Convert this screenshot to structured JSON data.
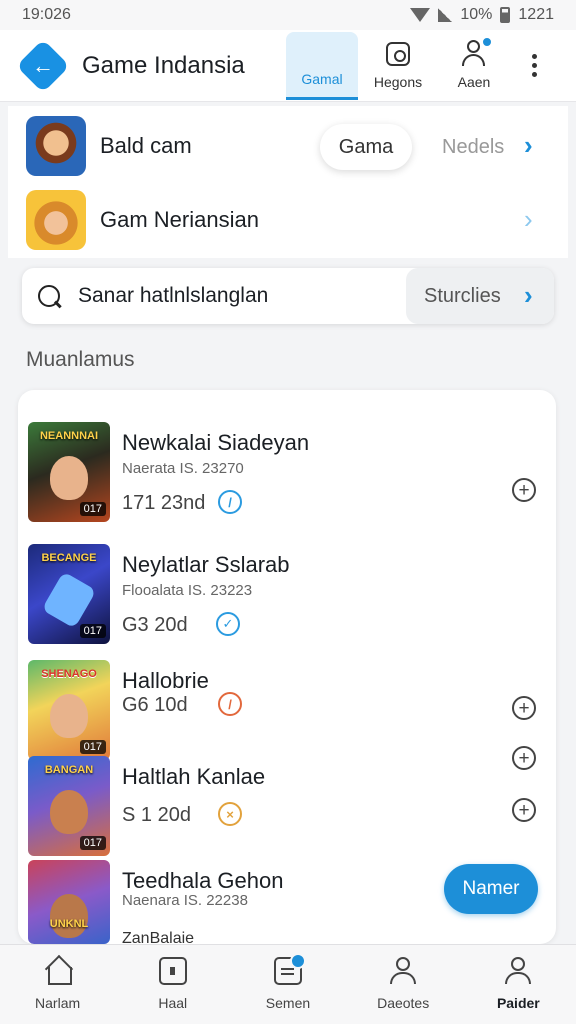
{
  "status_bar": {
    "time": "19:026",
    "battery": "10%",
    "clock": "1221"
  },
  "app_bar": {
    "title": "Game Indansia",
    "tabs": [
      {
        "label": "Gamal",
        "active": true
      },
      {
        "label": "Hegons",
        "active": false
      },
      {
        "label": "Aaen",
        "active": false
      }
    ]
  },
  "top_card": {
    "row1": {
      "title": "Bald cam",
      "pill": "Gama",
      "secondary": "Nedels"
    },
    "row2": {
      "title": "Gam Neriansian"
    }
  },
  "search": {
    "text": "Sanar hatlnlslanglan",
    "filter_label": "Sturclies"
  },
  "section_label": "Muanlamus",
  "games": [
    {
      "title": "Newkalai Siadeyan",
      "subtitle": "Naerata IS. 23270",
      "meta": "171 23nd",
      "cover_label": "NEANNNAI",
      "badge": "017",
      "status_icon": "slash-check-icon",
      "status_color": "#2b9be0"
    },
    {
      "title": "Neylatlar Sslarab",
      "subtitle": "Flooalata IS. 23223",
      "meta": "G3 20d",
      "cover_label": "BECANGE",
      "badge": "017",
      "status_icon": "check-badge-icon",
      "status_color": "#2b9be0"
    },
    {
      "title": "Hallobrie",
      "subtitle": "",
      "meta": "G6 10d",
      "cover_label": "SHENAGO",
      "badge": "017",
      "status_icon": "blocked-icon",
      "status_color": "#e2683c"
    },
    {
      "title": "Haltlah Kanlae",
      "subtitle": "",
      "meta": "S 1 20d",
      "cover_label": "BANGAN",
      "badge": "017",
      "status_icon": "x-circle-icon",
      "status_color": "#e2a23c"
    },
    {
      "title": "Teedhala Gehon",
      "subtitle": "Naenara IS. 22238",
      "meta": "",
      "cover_label": "UNKNL",
      "badge": "",
      "status_icon": "",
      "status_color": ""
    }
  ],
  "cta_label": "Namer",
  "peek_text": "ZanBalaie",
  "bottom_nav": [
    {
      "label": "Narlam"
    },
    {
      "label": "Haal"
    },
    {
      "label": "Semen"
    },
    {
      "label": "Daeotes"
    },
    {
      "label": "Paider"
    }
  ],
  "colors": {
    "accent": "#1d8fd8",
    "background": "#f3f4f6",
    "card": "#ffffff"
  }
}
